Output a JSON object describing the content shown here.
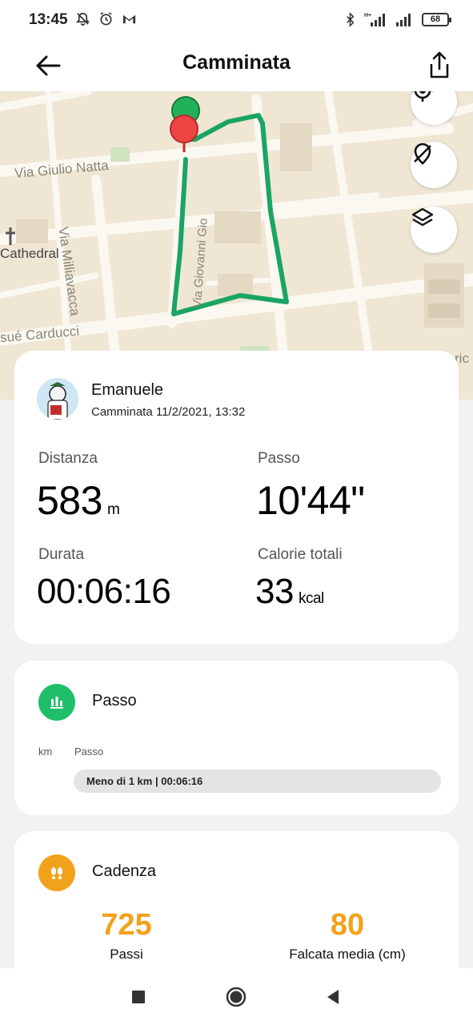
{
  "status_bar": {
    "time": "13:45",
    "network_label": "H+",
    "battery": "68"
  },
  "app_bar": {
    "title": "Camminata",
    "back_icon": "arrow-left-icon",
    "share_icon": "share-icon"
  },
  "map": {
    "labels": {
      "street1": "Via Giulio Natta",
      "street2": "Via Milliavacca",
      "street3": "Via Giovanni Gio",
      "street4": "sué Carducci",
      "place1": "Cathedral",
      "edge": "ric"
    },
    "buttons": [
      "locate-icon",
      "hide-route-icon",
      "layers-icon"
    ],
    "route_color": "#1aa564",
    "start_color": "#23b05a",
    "end_color": "#ee4444"
  },
  "summary": {
    "user_name": "Emanuele",
    "activity_line": "Camminata 11/2/2021, 13:32",
    "stats": {
      "distance_label": "Distanza",
      "distance_value": "583",
      "distance_unit": "m",
      "pace_label": "Passo",
      "pace_value": "10'44\"",
      "duration_label": "Durata",
      "duration_value": "00:06:16",
      "calories_label": "Calorie totali",
      "calories_value": "33",
      "calories_unit": "kcal"
    }
  },
  "pace_card": {
    "title": "Passo",
    "col_km": "km",
    "col_pace": "Passo",
    "row_text": "Meno di 1 km | 00:06:16",
    "icon_color": "#1fbf6a"
  },
  "cadence_card": {
    "title": "Cadenza",
    "steps_value": "725",
    "steps_label": "Passi",
    "stride_value": "80",
    "stride_label": "Falcata media (cm)",
    "icon_color": "#f2a21a"
  },
  "nav": [
    "recents-button",
    "home-button",
    "back-button"
  ]
}
